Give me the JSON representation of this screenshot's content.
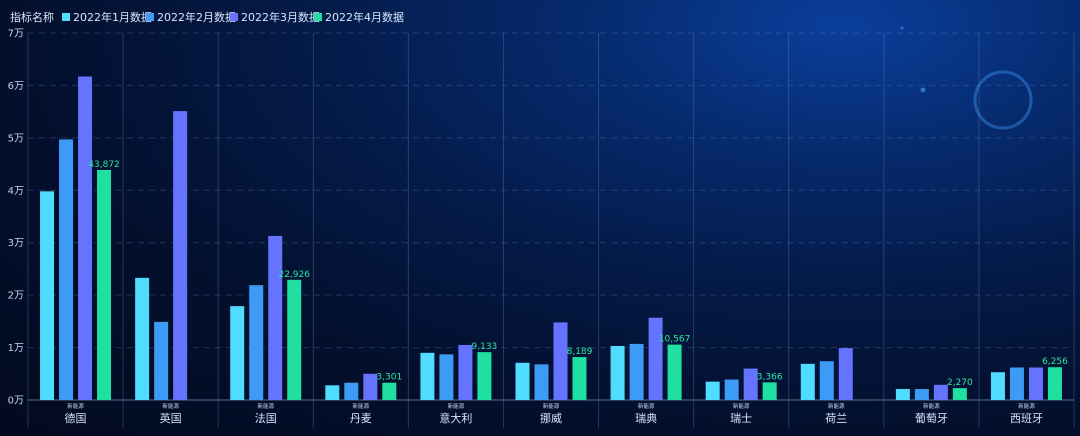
{
  "chart_data": {
    "type": "bar",
    "title": "",
    "legend_title": "指标名称",
    "legend_position": "top-left",
    "grid": true,
    "ylim": [
      0,
      70000
    ],
    "ytick_values": [
      0,
      10000,
      20000,
      30000,
      40000,
      50000,
      60000,
      70000
    ],
    "ytick_labels": [
      "0万",
      "1万",
      "2万",
      "3万",
      "4万",
      "5万",
      "6万",
      "7万"
    ],
    "categories": [
      "德国",
      "英国",
      "法国",
      "丹麦",
      "意大利",
      "挪威",
      "瑞典",
      "瑞士",
      "荷兰",
      "葡萄牙",
      "西班牙"
    ],
    "category_sublabel": "新能源",
    "series": [
      {
        "name": "2022年1月数据",
        "color": "#4fdcff",
        "values": [
          39800,
          23300,
          17900,
          2800,
          9000,
          7100,
          10300,
          3500,
          6900,
          2100,
          5300
        ]
      },
      {
        "name": "2022年2月数据",
        "color": "#3d9bf5",
        "values": [
          49700,
          14900,
          21900,
          3300,
          8700,
          6800,
          10700,
          3900,
          7400,
          2100,
          6200
        ]
      },
      {
        "name": "2022年3月数据",
        "color": "#6574ff",
        "values": [
          61700,
          55100,
          31300,
          5000,
          10500,
          14800,
          15700,
          6000,
          9900,
          2900,
          6200
        ]
      },
      {
        "name": "2022年4月数据",
        "color": "#1fe0a0",
        "values": [
          43872,
          0,
          22926,
          3301,
          9133,
          8189,
          10567,
          3366,
          0,
          2270,
          6256
        ]
      }
    ],
    "data_labels": {
      "series": "2022年4月数据",
      "texts": [
        "43,872",
        "",
        "22,926",
        "3,301",
        "9,133",
        "8,189",
        "10,567",
        "3,366",
        "",
        "2,270",
        "6,256"
      ]
    }
  }
}
